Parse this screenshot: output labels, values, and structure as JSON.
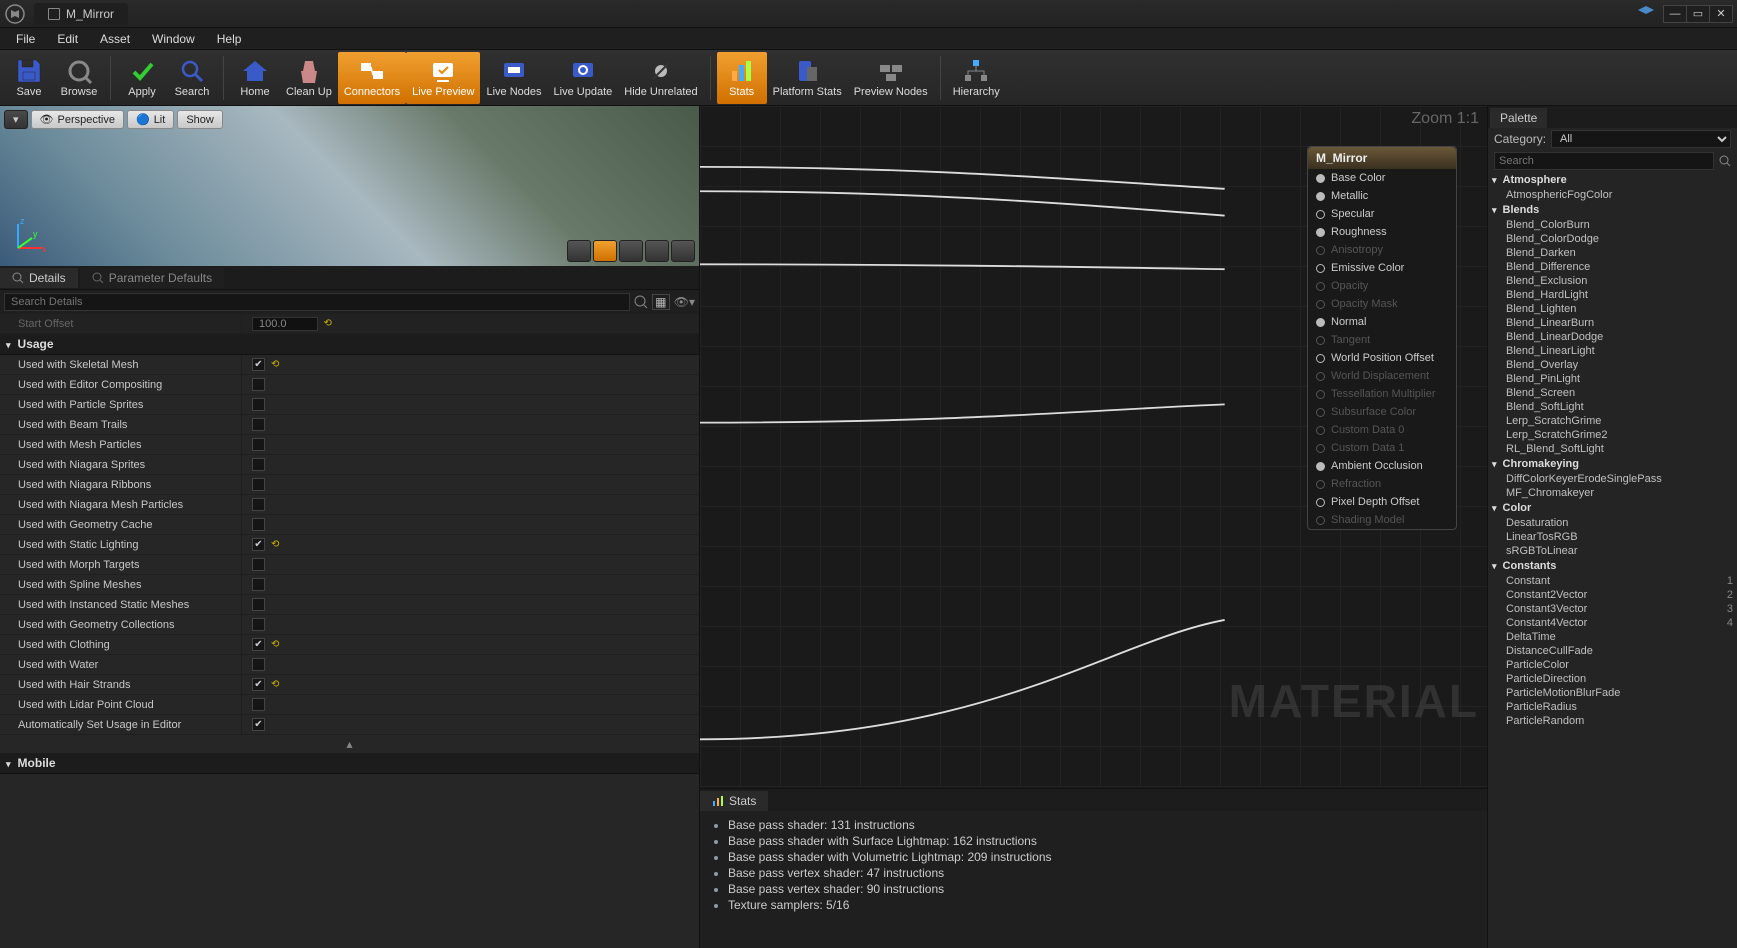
{
  "titlebar": {
    "docName": "M_Mirror"
  },
  "menu": [
    "File",
    "Edit",
    "Asset",
    "Window",
    "Help"
  ],
  "toolbar": [
    {
      "label": "Save",
      "active": false,
      "icon": "save"
    },
    {
      "label": "Browse",
      "active": false,
      "icon": "browse"
    },
    {
      "sep": true
    },
    {
      "label": "Apply",
      "active": false,
      "icon": "apply"
    },
    {
      "label": "Search",
      "active": false,
      "icon": "search"
    },
    {
      "sep": true
    },
    {
      "label": "Home",
      "active": false,
      "icon": "home"
    },
    {
      "label": "Clean Up",
      "active": false,
      "icon": "clean"
    },
    {
      "label": "Connectors",
      "active": true,
      "icon": "connectors"
    },
    {
      "label": "Live Preview",
      "active": true,
      "icon": "livepreview"
    },
    {
      "label": "Live Nodes",
      "active": false,
      "icon": "livenodes"
    },
    {
      "label": "Live Update",
      "active": false,
      "icon": "liveupdate"
    },
    {
      "label": "Hide Unrelated",
      "active": false,
      "icon": "hide"
    },
    {
      "sep": true
    },
    {
      "label": "Stats",
      "active": true,
      "icon": "stats"
    },
    {
      "label": "Platform Stats",
      "active": false,
      "icon": "platform"
    },
    {
      "label": "Preview Nodes",
      "active": false,
      "icon": "preview"
    },
    {
      "sep": true
    },
    {
      "label": "Hierarchy",
      "active": false,
      "icon": "hierarchy"
    }
  ],
  "viewport": {
    "buttons": [
      "Perspective",
      "Lit",
      "Show"
    ],
    "axisX": "x",
    "axisY": "y",
    "axisZ": "z"
  },
  "detailTabs": {
    "a": "Details",
    "b": "Parameter Defaults"
  },
  "searchPlaceholder": "Search Details",
  "firstTruncated": {
    "label": "Start Offset",
    "value": "100.0"
  },
  "usageHeader": "Usage",
  "usage": [
    {
      "label": "Used with Skeletal Mesh",
      "checked": true,
      "reset": true
    },
    {
      "label": "Used with Editor Compositing",
      "checked": false
    },
    {
      "label": "Used with Particle Sprites",
      "checked": false
    },
    {
      "label": "Used with Beam Trails",
      "checked": false
    },
    {
      "label": "Used with Mesh Particles",
      "checked": false
    },
    {
      "label": "Used with Niagara Sprites",
      "checked": false
    },
    {
      "label": "Used with Niagara Ribbons",
      "checked": false
    },
    {
      "label": "Used with Niagara Mesh Particles",
      "checked": false
    },
    {
      "label": "Used with Geometry Cache",
      "checked": false
    },
    {
      "label": "Used with Static Lighting",
      "checked": true,
      "reset": true
    },
    {
      "label": "Used with Morph Targets",
      "checked": false
    },
    {
      "label": "Used with Spline Meshes",
      "checked": false
    },
    {
      "label": "Used with Instanced Static Meshes",
      "checked": false
    },
    {
      "label": "Used with Geometry Collections",
      "checked": false
    },
    {
      "label": "Used with Clothing",
      "checked": true,
      "reset": true
    },
    {
      "label": "Used with Water",
      "checked": false
    },
    {
      "label": "Used with Hair Strands",
      "checked": true,
      "reset": true
    },
    {
      "label": "Used with Lidar Point Cloud",
      "checked": false
    },
    {
      "label": "Automatically Set Usage in Editor",
      "checked": true
    }
  ],
  "mobileHeader": "Mobile",
  "graph": {
    "zoom": "Zoom 1:1",
    "watermark": "MATERIAL",
    "nodeTitle": "M_Mirror",
    "pins": [
      {
        "label": "Base Color",
        "enabled": true,
        "filled": true
      },
      {
        "label": "Metallic",
        "enabled": true,
        "filled": true
      },
      {
        "label": "Specular",
        "enabled": true
      },
      {
        "label": "Roughness",
        "enabled": true,
        "filled": true
      },
      {
        "label": "Anisotropy",
        "enabled": false
      },
      {
        "label": "Emissive Color",
        "enabled": true
      },
      {
        "label": "Opacity",
        "enabled": false
      },
      {
        "label": "Opacity Mask",
        "enabled": false
      },
      {
        "label": "Normal",
        "enabled": true,
        "filled": true
      },
      {
        "label": "Tangent",
        "enabled": false
      },
      {
        "label": "World Position Offset",
        "enabled": true
      },
      {
        "label": "World Displacement",
        "enabled": false
      },
      {
        "label": "Tessellation Multiplier",
        "enabled": false
      },
      {
        "label": "Subsurface Color",
        "enabled": false
      },
      {
        "label": "Custom Data 0",
        "enabled": false
      },
      {
        "label": "Custom Data 1",
        "enabled": false
      },
      {
        "label": "Ambient Occlusion",
        "enabled": true,
        "filled": true
      },
      {
        "label": "Refraction",
        "enabled": false
      },
      {
        "label": "Pixel Depth Offset",
        "enabled": true
      },
      {
        "label": "Shading Model",
        "enabled": false
      }
    ]
  },
  "statsTab": "Stats",
  "stats": [
    "Base pass shader: 131 instructions",
    "Base pass shader with Surface Lightmap: 162 instructions",
    "Base pass shader with Volumetric Lightmap: 209 instructions",
    "Base pass vertex shader: 47 instructions",
    "Base pass vertex shader: 90 instructions",
    "Texture samplers: 5/16"
  ],
  "palette": {
    "title": "Palette",
    "categoryLabel": "Category:",
    "categoryValue": "All",
    "searchPlaceholder": "Search",
    "groups": [
      {
        "name": "Atmosphere",
        "items": [
          {
            "n": "AtmosphericFogColor"
          }
        ]
      },
      {
        "name": "Blends",
        "items": [
          {
            "n": "Blend_ColorBurn"
          },
          {
            "n": "Blend_ColorDodge"
          },
          {
            "n": "Blend_Darken"
          },
          {
            "n": "Blend_Difference"
          },
          {
            "n": "Blend_Exclusion"
          },
          {
            "n": "Blend_HardLight"
          },
          {
            "n": "Blend_Lighten"
          },
          {
            "n": "Blend_LinearBurn"
          },
          {
            "n": "Blend_LinearDodge"
          },
          {
            "n": "Blend_LinearLight"
          },
          {
            "n": "Blend_Overlay"
          },
          {
            "n": "Blend_PinLight"
          },
          {
            "n": "Blend_Screen"
          },
          {
            "n": "Blend_SoftLight"
          },
          {
            "n": "Lerp_ScratchGrime"
          },
          {
            "n": "Lerp_ScratchGrime2"
          },
          {
            "n": "RL_Blend_SoftLight"
          }
        ]
      },
      {
        "name": "Chromakeying",
        "items": [
          {
            "n": "DiffColorKeyerErodeSinglePass"
          },
          {
            "n": "MF_Chromakeyer"
          }
        ]
      },
      {
        "name": "Color",
        "items": [
          {
            "n": "Desaturation"
          },
          {
            "n": "LinearTosRGB"
          },
          {
            "n": "sRGBToLinear"
          }
        ]
      },
      {
        "name": "Constants",
        "items": [
          {
            "n": "Constant",
            "s": "1"
          },
          {
            "n": "Constant2Vector",
            "s": "2"
          },
          {
            "n": "Constant3Vector",
            "s": "3"
          },
          {
            "n": "Constant4Vector",
            "s": "4"
          },
          {
            "n": "DeltaTime"
          },
          {
            "n": "DistanceCullFade"
          },
          {
            "n": "ParticleColor"
          },
          {
            "n": "ParticleDirection"
          },
          {
            "n": "ParticleMotionBlurFade"
          },
          {
            "n": "ParticleRadius"
          },
          {
            "n": "ParticleRandom"
          }
        ]
      }
    ]
  }
}
